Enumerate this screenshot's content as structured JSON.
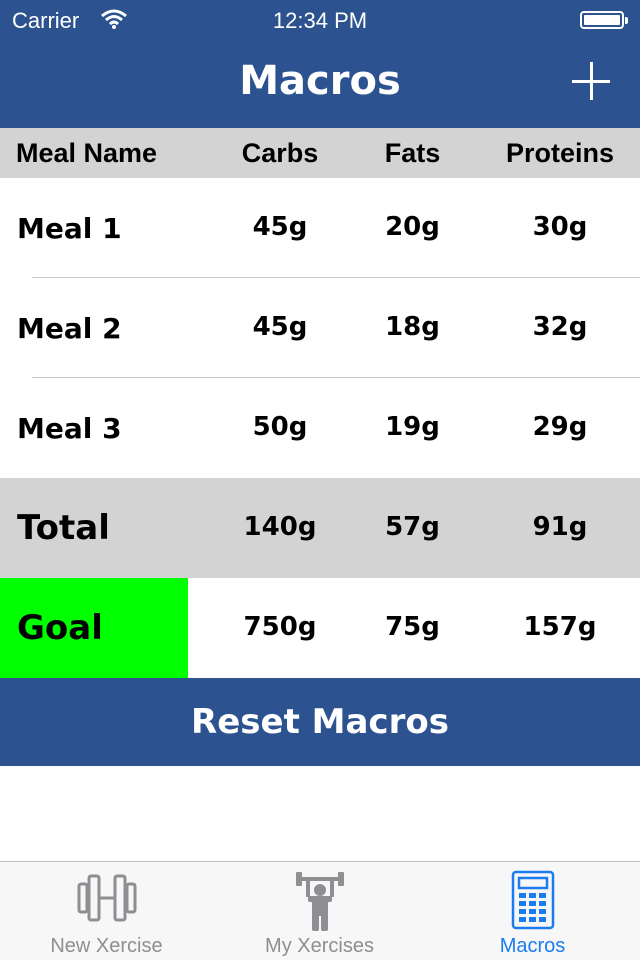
{
  "status": {
    "carrier": "Carrier",
    "time": "12:34 PM"
  },
  "nav": {
    "title": "Macros"
  },
  "table": {
    "headers": {
      "name": "Meal Name",
      "carbs": "Carbs",
      "fats": "Fats",
      "proteins": "Proteins"
    },
    "meals": [
      {
        "name": "Meal 1",
        "carbs": "45g",
        "fats": "20g",
        "proteins": "30g"
      },
      {
        "name": "Meal 2",
        "carbs": "45g",
        "fats": "18g",
        "proteins": "32g"
      },
      {
        "name": "Meal 3",
        "carbs": "50g",
        "fats": "19g",
        "proteins": "29g"
      }
    ],
    "total": {
      "name": "Total",
      "carbs": "140g",
      "fats": "57g",
      "proteins": "91g"
    },
    "goal": {
      "name": "Goal",
      "carbs": "750g",
      "fats": "75g",
      "proteins": "157g"
    }
  },
  "reset_label": "Reset Macros",
  "tabs": [
    {
      "label": "New Xercise",
      "icon": "dumbbell-icon"
    },
    {
      "label": "My Xercises",
      "icon": "weightlifter-icon"
    },
    {
      "label": "Macros",
      "icon": "calculator-icon"
    }
  ],
  "colors": {
    "bar": "#2d5290",
    "goal_highlight": "#00ff00",
    "active_tab": "#1a7cf0"
  }
}
